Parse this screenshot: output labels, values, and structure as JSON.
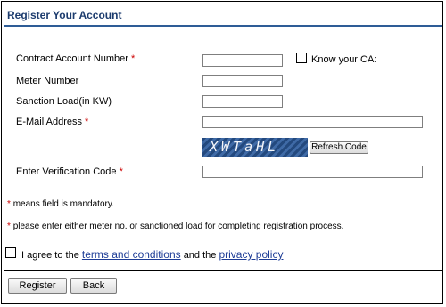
{
  "page": {
    "title": "Register Your Account"
  },
  "form": {
    "contract_account": {
      "label": "Contract Account Number",
      "required": "*",
      "value": ""
    },
    "know_ca": {
      "label": "Know your CA:"
    },
    "meter_number": {
      "label": "Meter Number",
      "value": ""
    },
    "sanction_load": {
      "label": "Sanction Load(in KW)",
      "value": ""
    },
    "email": {
      "label": "E-Mail Address",
      "required": "*",
      "value": ""
    },
    "captcha": {
      "text": "XWTaHL",
      "refresh_label": "Refresh Code"
    },
    "verification": {
      "label": "Enter Verification Code",
      "required": "*",
      "value": ""
    }
  },
  "notes": {
    "mandatory_star": "*",
    "mandatory_text": "means field is mandatory.",
    "meter_star": "*",
    "meter_text": "please enter either meter no. or sanctioned load for completing registration process."
  },
  "agreement": {
    "prefix": "I agree to the",
    "terms_link": "terms and conditions",
    "middle": "and the",
    "privacy_link": "privacy policy"
  },
  "buttons": {
    "register": "Register",
    "back": "Back"
  }
}
